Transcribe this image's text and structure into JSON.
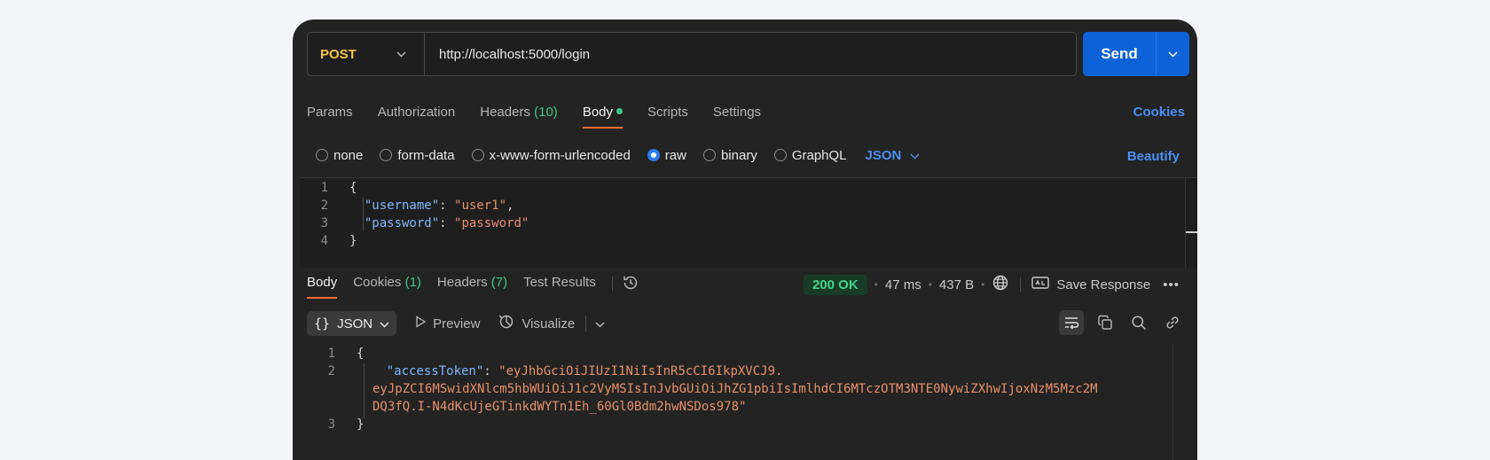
{
  "request": {
    "method": "POST",
    "url": "http://localhost:5000/login",
    "send_label": "Send"
  },
  "req_tabs": [
    {
      "label": "Params"
    },
    {
      "label": "Authorization"
    },
    {
      "label": "Headers",
      "count": "(10)"
    },
    {
      "label": "Body"
    },
    {
      "label": "Scripts"
    },
    {
      "label": "Settings"
    }
  ],
  "cookies_label": "Cookies",
  "body_types": {
    "none": "none",
    "form_data": "form-data",
    "urlencoded": "x-www-form-urlencoded",
    "raw": "raw",
    "binary": "binary",
    "graphql": "GraphQL",
    "format": "JSON"
  },
  "beautify_label": "Beautify",
  "request_body": {
    "ln": [
      "1",
      "2",
      "3",
      "4"
    ],
    "open": "{",
    "username_key": "\"username\"",
    "username_val": "\"user1\"",
    "password_key": "\"password\"",
    "password_val": "\"password\"",
    "close": "}"
  },
  "resp_tabs": {
    "body": "Body",
    "cookies": "Cookies",
    "cookies_count": "(1)",
    "headers": "Headers",
    "headers_count": "(7)",
    "tests": "Test Results"
  },
  "status": {
    "code": "200 OK",
    "time": "47 ms",
    "size": "437 B",
    "save_label": "Save Response"
  },
  "resp_toolbar": {
    "format": "JSON",
    "preview": "Preview",
    "visualize": "Visualize"
  },
  "response_body": {
    "ln": [
      "1",
      "2",
      "3"
    ],
    "open": "{",
    "key": "\"accessToken\"",
    "line1": "\"eyJhbGciOiJIUzI1NiIsInR5cCI6IkpXVCJ9.",
    "line2": "eyJpZCI6MSwidXNlcm5hbWUiOiJ1c2VyMSIsInJvbGUiOiJhZG1pbiIsImlhdCI6MTczOTM3NTE0NywiZXhwIjoxNzM5Mzc2M",
    "line3": "DQ3fQ.I-N4dKcUjeGTinkdWYTn1Eh_60Gl0Bdm2hwNSDos978\"",
    "close": "}"
  }
}
